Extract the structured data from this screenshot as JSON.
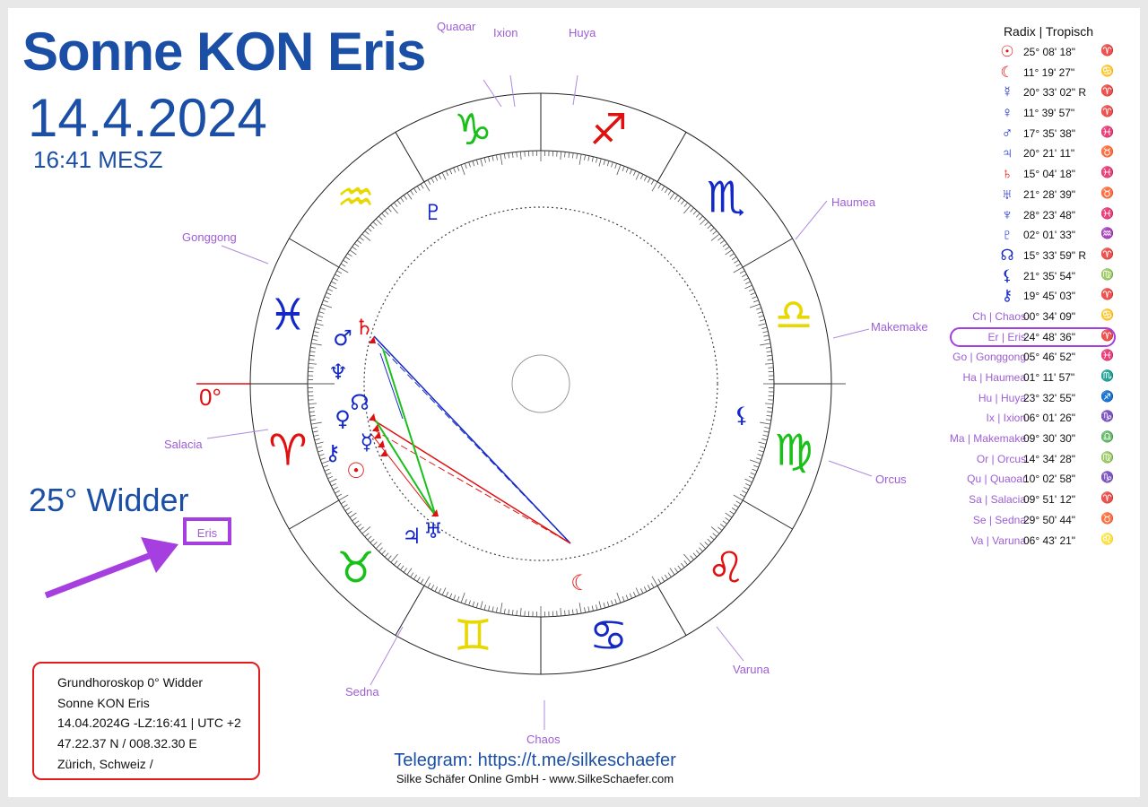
{
  "header": {
    "title": "Sonne KON Eris",
    "date": "14.4.2024",
    "time": "16:41 MESZ"
  },
  "annotation": {
    "sign_degree": "25° Widder",
    "zero_label": "0°",
    "eris_label": "Eris"
  },
  "table": {
    "header": "Radix | Tropisch",
    "rows": [
      {
        "glyph": "☉",
        "glyph_icon": "sun-icon",
        "name": "",
        "position": "25° 08' 18\"",
        "sign_icon": "aries-icon",
        "color": "#e01010"
      },
      {
        "glyph": "☾",
        "glyph_icon": "moon-icon",
        "name": "",
        "position": "11° 19' 27\"",
        "sign_icon": "cancer-icon",
        "color": "#e01010"
      },
      {
        "glyph": "☿",
        "glyph_icon": "mercury-icon",
        "name": "",
        "position": "20° 33' 02\" R",
        "sign_icon": "aries-icon",
        "color": "#1428c8"
      },
      {
        "glyph": "♀",
        "glyph_icon": "venus-icon",
        "name": "",
        "position": "11° 39' 57\"",
        "sign_icon": "aries-icon",
        "color": "#1428c8"
      },
      {
        "glyph": "♂",
        "glyph_icon": "mars-icon",
        "name": "",
        "position": "17° 35' 38\"",
        "sign_icon": "pisces-icon",
        "color": "#1428c8"
      },
      {
        "glyph": "♃",
        "glyph_icon": "jupiter-icon",
        "name": "",
        "position": "20° 21' 11\"",
        "sign_icon": "taurus-icon",
        "color": "#1428c8"
      },
      {
        "glyph": "♄",
        "glyph_icon": "saturn-icon",
        "name": "",
        "position": "15° 04' 18\"",
        "sign_icon": "pisces-icon",
        "color": "#e01010"
      },
      {
        "glyph": "♅",
        "glyph_icon": "uranus-icon",
        "name": "",
        "position": "21° 28' 39\"",
        "sign_icon": "taurus-icon",
        "color": "#1428c8"
      },
      {
        "glyph": "♆",
        "glyph_icon": "neptune-icon",
        "name": "",
        "position": "28° 23' 48\"",
        "sign_icon": "pisces-icon",
        "color": "#1428c8"
      },
      {
        "glyph": "♇",
        "glyph_icon": "pluto-icon",
        "name": "",
        "position": "02° 01' 33\"",
        "sign_icon": "aquarius-icon",
        "color": "#1428c8"
      },
      {
        "glyph": "☊",
        "glyph_icon": "node-icon",
        "name": "",
        "position": "15° 33' 59\" R",
        "sign_icon": "aries-icon",
        "color": "#1428c8"
      },
      {
        "glyph": "⚸",
        "glyph_icon": "lilith-icon",
        "name": "",
        "position": "21° 35' 54\"",
        "sign_icon": "virgo-icon",
        "color": "#1428c8"
      },
      {
        "glyph": "⚷",
        "glyph_icon": "chiron-icon",
        "name": "",
        "position": "19° 45' 03\"",
        "sign_icon": "aries-icon",
        "color": "#1428c8"
      },
      {
        "glyph": "",
        "glyph_icon": "",
        "name": "Ch | Chaos",
        "position": "00° 34' 09\"",
        "sign_icon": "cancer-icon",
        "color": "#1428c8"
      },
      {
        "glyph": "",
        "glyph_icon": "",
        "name": "Er | Eris",
        "position": "24° 48' 36\"",
        "sign_icon": "aries-icon",
        "color": "#e01010"
      },
      {
        "glyph": "",
        "glyph_icon": "",
        "name": "Go | Gonggong",
        "position": "05° 46' 52\"",
        "sign_icon": "pisces-icon",
        "color": "#1428c8"
      },
      {
        "glyph": "",
        "glyph_icon": "",
        "name": "Ha | Haumea",
        "position": "01° 11' 57\"",
        "sign_icon": "scorpio-icon",
        "color": "#1428c8"
      },
      {
        "glyph": "",
        "glyph_icon": "",
        "name": "Hu | Huya",
        "position": "23° 32' 55\"",
        "sign_icon": "sagittarius-icon",
        "color": "#e01010"
      },
      {
        "glyph": "",
        "glyph_icon": "",
        "name": "Ix | Ixion",
        "position": "06° 01' 26\"",
        "sign_icon": "capricorn-icon",
        "color": "#18c018"
      },
      {
        "glyph": "",
        "glyph_icon": "",
        "name": "Ma | Makemake",
        "position": "09° 30' 30\"",
        "sign_icon": "libra-icon",
        "color": "#e8d800"
      },
      {
        "glyph": "",
        "glyph_icon": "",
        "name": "Or | Orcus",
        "position": "14° 34' 28\"",
        "sign_icon": "virgo-icon",
        "color": "#18c018"
      },
      {
        "glyph": "",
        "glyph_icon": "",
        "name": "Qu | Quaoar",
        "position": "10° 02' 58\"",
        "sign_icon": "capricorn-icon",
        "color": "#18c018"
      },
      {
        "glyph": "",
        "glyph_icon": "",
        "name": "Sa | Salacia",
        "position": "09° 51' 12\"",
        "sign_icon": "aries-icon",
        "color": "#e01010"
      },
      {
        "glyph": "",
        "glyph_icon": "",
        "name": "Se | Sedna",
        "position": "29° 50' 44\"",
        "sign_icon": "taurus-icon",
        "color": "#18c018"
      },
      {
        "glyph": "",
        "glyph_icon": "",
        "name": "Va | Varuna",
        "position": "06° 43' 21\"",
        "sign_icon": "leo-icon",
        "color": "#e01010"
      }
    ]
  },
  "wheel": {
    "signs": [
      {
        "name": "aries",
        "icon": "aries-icon",
        "glyph": "♈",
        "color": "#e01010"
      },
      {
        "name": "taurus",
        "icon": "taurus-icon",
        "glyph": "♉",
        "color": "#18c018"
      },
      {
        "name": "gemini",
        "icon": "gemini-icon",
        "glyph": "♊",
        "color": "#e8d800"
      },
      {
        "name": "cancer",
        "icon": "cancer-icon",
        "glyph": "♋",
        "color": "#1428c8"
      },
      {
        "name": "leo",
        "icon": "leo-icon",
        "glyph": "♌",
        "color": "#e01010"
      },
      {
        "name": "virgo",
        "icon": "virgo-icon",
        "glyph": "♍",
        "color": "#18c018"
      },
      {
        "name": "libra",
        "icon": "libra-icon",
        "glyph": "♎",
        "color": "#e8d800"
      },
      {
        "name": "scorpio",
        "icon": "scorpio-icon",
        "glyph": "♏",
        "color": "#1428c8"
      },
      {
        "name": "sagittarius",
        "icon": "sagittarius-icon",
        "glyph": "♐",
        "color": "#e01010"
      },
      {
        "name": "capricorn",
        "icon": "capricorn-icon",
        "glyph": "♑",
        "color": "#18c018"
      },
      {
        "name": "aquarius",
        "icon": "aquarius-icon",
        "glyph": "♒",
        "color": "#e8d800"
      },
      {
        "name": "pisces",
        "icon": "pisces-icon",
        "glyph": "♓",
        "color": "#1428c8"
      }
    ],
    "outer_bodies": [
      {
        "label": "Quaoar"
      },
      {
        "label": "Ixion"
      },
      {
        "label": "Huya"
      },
      {
        "label": "Haumea"
      },
      {
        "label": "Makemake"
      },
      {
        "label": "Orcus"
      },
      {
        "label": "Varuna"
      },
      {
        "label": "Chaos"
      },
      {
        "label": "Sedna"
      },
      {
        "label": "Salacia"
      },
      {
        "label": "Gonggong"
      }
    ]
  },
  "info_box": {
    "lines": [
      "Grundhoroskop 0° Widder",
      "Sonne KON Eris",
      "14.04.2024G -LZ:16:41 | UTC +2",
      "47.22.37 N / 008.32.30 E",
      "Zürich, Schweiz /"
    ]
  },
  "footer": {
    "telegram": "Telegram: https://t.me/silkeschaefer",
    "company": "Silke Schäfer Online GmbH - www.SilkeSchaefer.com"
  },
  "colors": {
    "accent_blue": "#1b4fa6",
    "label_purple": "#9d5ed6",
    "highlight_purple": "#a63fe0",
    "red": "#e01010",
    "blue": "#1428c8",
    "green": "#18c018",
    "yellow": "#e8d800"
  }
}
